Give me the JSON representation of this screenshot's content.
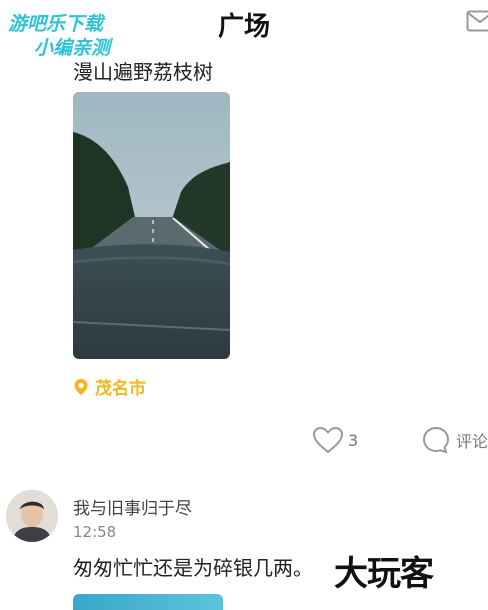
{
  "watermark": {
    "line1": "游吧乐下载",
    "line2": "小编亲测"
  },
  "header": {
    "title": "广场",
    "mail_icon": "mail-icon"
  },
  "post1": {
    "text": "漫山遍野荔枝树",
    "location": "茂名市",
    "likes": "3",
    "comment_label": "评论"
  },
  "post2": {
    "username": "我与旧事归于尽",
    "time": "12:58",
    "text": "匆匆忙忙还是为碎银几两。",
    "brand_mark": "大玩客"
  },
  "colors": {
    "location": "#f3b61e",
    "watermark": "#2ec4d6"
  }
}
